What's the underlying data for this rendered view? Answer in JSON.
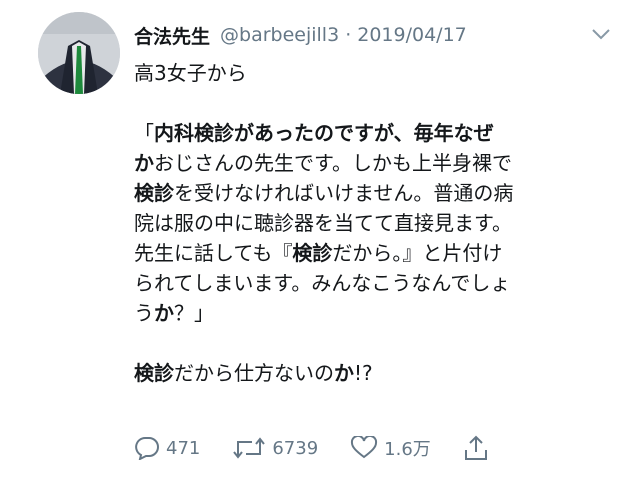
{
  "tweet": {
    "author_name": "合法先生",
    "handle": "@barbeejill3",
    "separator": "·",
    "date": "2019/04/17"
  },
  "body": {
    "line1": "高3女子から",
    "para": [
      {
        "parts": [
          {
            "t": "「",
            "b": false
          },
          {
            "t": "内科検診があったのですが、毎年なぜ",
            "b": true
          }
        ]
      },
      {
        "parts": [
          {
            "t": "か",
            "b": true
          },
          {
            "t": "おじさんの先生です。しかも上半身裸で",
            "b": false
          }
        ]
      },
      {
        "parts": [
          {
            "t": "検診",
            "b": true
          },
          {
            "t": "を受けなければいけません。普通の病",
            "b": false
          }
        ]
      },
      {
        "parts": [
          {
            "t": "院は服の中に聴診器を当てて直接見ます。",
            "b": false
          }
        ]
      },
      {
        "parts": [
          {
            "t": "先生に話しても『",
            "b": false
          },
          {
            "t": "検診",
            "b": true
          },
          {
            "t": "だから。』と片付け",
            "b": false
          }
        ]
      },
      {
        "parts": [
          {
            "t": "られてしまいます。みんなこうなんでしょ",
            "b": false
          }
        ]
      },
      {
        "parts": [
          {
            "t": "う",
            "b": false
          },
          {
            "t": "か",
            "b": true
          },
          {
            "t": "？」",
            "b": false
          }
        ]
      }
    ],
    "last": [
      {
        "t": "検診",
        "b": true
      },
      {
        "t": "だから仕方ないの",
        "b": false
      },
      {
        "t": "か",
        "b": true
      },
      {
        "t": "!?",
        "b": false
      }
    ]
  },
  "actions": {
    "reply_count": "471",
    "retweet_count": "6739",
    "like_count": "1.6万"
  },
  "icons": {
    "reply": "reply-icon",
    "retweet": "retweet-icon",
    "like": "heart-icon",
    "share": "share-icon",
    "caret": "chevron-down-icon"
  },
  "colors": {
    "text": "#14171a",
    "muted": "#657786"
  }
}
